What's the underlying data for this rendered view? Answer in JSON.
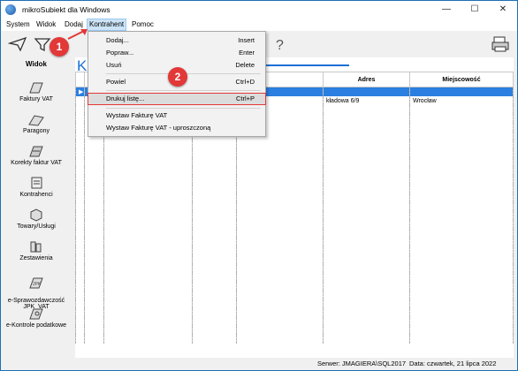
{
  "window": {
    "title": "mikroSubiekt dla Windows",
    "minimize": "—",
    "maximize": "☐",
    "close": "✕"
  },
  "menu": {
    "items": [
      "System",
      "Widok",
      "Dodaj",
      "Kontrahent",
      "Pomoc"
    ]
  },
  "sidebar": {
    "header": "Widok",
    "items": [
      {
        "label": "Faktury VAT"
      },
      {
        "label": "Paragony"
      },
      {
        "label": "Korekty faktur VAT"
      },
      {
        "label": "Kontrahenci"
      },
      {
        "label": "Towary/Usługi"
      },
      {
        "label": "Zestawienia"
      },
      {
        "label": "e-Sprawozdawczość\nJPK_VAT"
      },
      {
        "label": "e-Kontrole podatkowe"
      }
    ]
  },
  "content": {
    "title_partial": "K",
    "columns": [
      "",
      "",
      "",
      "",
      "Adres",
      "Miejscowość"
    ],
    "row1": {
      "adres": "kładowa 6/9",
      "miejscowosc": "Wrocław"
    }
  },
  "context_menu": {
    "items": [
      {
        "label": "Dodaj...",
        "shortcut": "Insert"
      },
      {
        "label": "Popraw...",
        "shortcut": "Enter"
      },
      {
        "label": "Usuń",
        "shortcut": "Delete"
      },
      {
        "label": "Powiel",
        "shortcut": "Ctrl+D"
      },
      {
        "label": "Drukuj listę...",
        "shortcut": "Ctrl+P"
      },
      {
        "label": "Wystaw Fakturę VAT",
        "shortcut": ""
      },
      {
        "label": "Wystaw Fakturę VAT - uproszczoną",
        "shortcut": ""
      }
    ]
  },
  "annotations": {
    "badge1": "1",
    "badge2": "2"
  },
  "status": {
    "server": "Serwer: JMAGIERA\\SQL2017",
    "date": "Data: czwartek, 21 lipca 2022"
  },
  "colors": {
    "accent": "#1a6fd6",
    "selection": "#2b7fe0",
    "annotation": "#e23838"
  }
}
